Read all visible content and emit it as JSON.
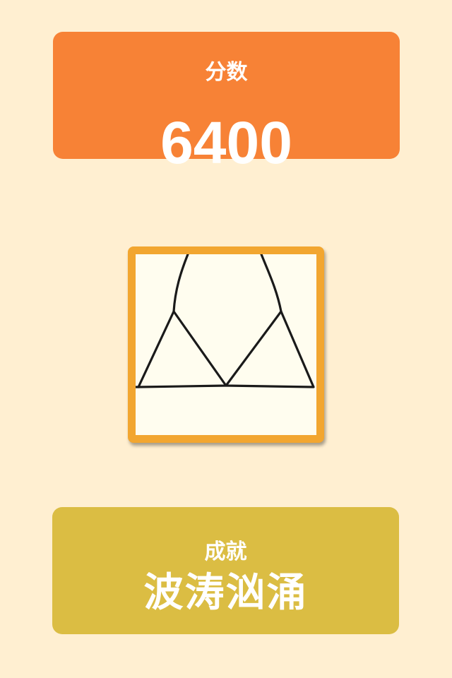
{
  "colors": {
    "background": "#ffefd1",
    "score_card": "#f78236",
    "frame_border": "#f2a630",
    "frame_paper": "#fffdef",
    "achievement_card": "#dbbd43",
    "text": "#ffffff",
    "ink": "#1a1a1a"
  },
  "score": {
    "label": "分数",
    "value": "6400"
  },
  "picture": {
    "icon": "bikini-top-drawing"
  },
  "achievement": {
    "label": "成就",
    "title": "波涛汹涌"
  }
}
